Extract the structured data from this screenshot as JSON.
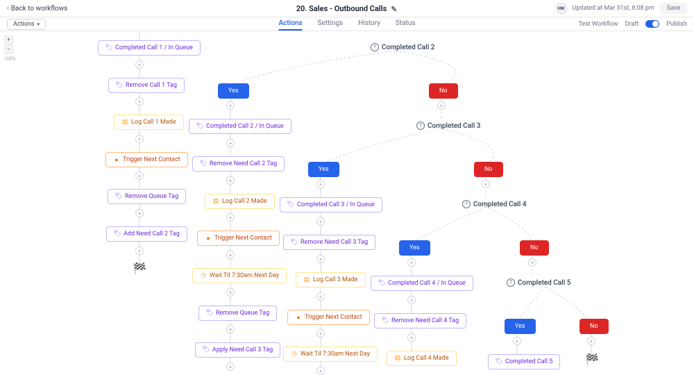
{
  "header": {
    "back": "Back to workflows",
    "title": "20. Sales - Outbound Calls",
    "avatar": "HW",
    "updated": "Updated at Mar 31st, 8:08 pm",
    "save": "Save"
  },
  "subbar": {
    "actions": "Actions",
    "tabs": [
      "Actions",
      "Settings",
      "History",
      "Status"
    ],
    "test": "Test Workflow",
    "draft": "Draft",
    "publish": "Publish"
  },
  "zoom": {
    "pct": "100%"
  },
  "conds": {
    "c2": "Completed Call 2",
    "c3": "Completed Call 3",
    "c4": "Completed Call 4",
    "c5": "Completed Call 5"
  },
  "yn": {
    "yes": "Yes",
    "no": "No"
  },
  "col1": {
    "n1": "Completed Call 1 / In Queue",
    "n2": "Remove Call 1 Tag",
    "n3": "Log Call 1 Made",
    "n4": "Trigger Next Contact",
    "n5": "Remove Queue Tag",
    "n6": "Add Need Call 2 Tag"
  },
  "col2": {
    "n1": "Completed Call 2 / In Queue",
    "n2": "Remove Need Call 2 Tag",
    "n3": "Log Call 2 Made",
    "n4": "Trigger Next Contact",
    "n5": "Wait Til 7:30am Next Day",
    "n6": "Remove Queue Tag",
    "n7": "Apply Need Call 3 Tag"
  },
  "col3": {
    "n1": "Completed Call 3 / In Queue",
    "n2": "Remove Need Call 3 Tag",
    "n3": "Log Call 3 Made",
    "n4": "Trigger Next Contact",
    "n5": "Wait Til 7:30am Next Day"
  },
  "col4": {
    "n1": "Completed Call 4 / In Queue",
    "n2": "Remove Need Call 4 Tag",
    "n3": "Log Call 4 Made"
  },
  "col5": {
    "n1": "Completed Call 5"
  }
}
